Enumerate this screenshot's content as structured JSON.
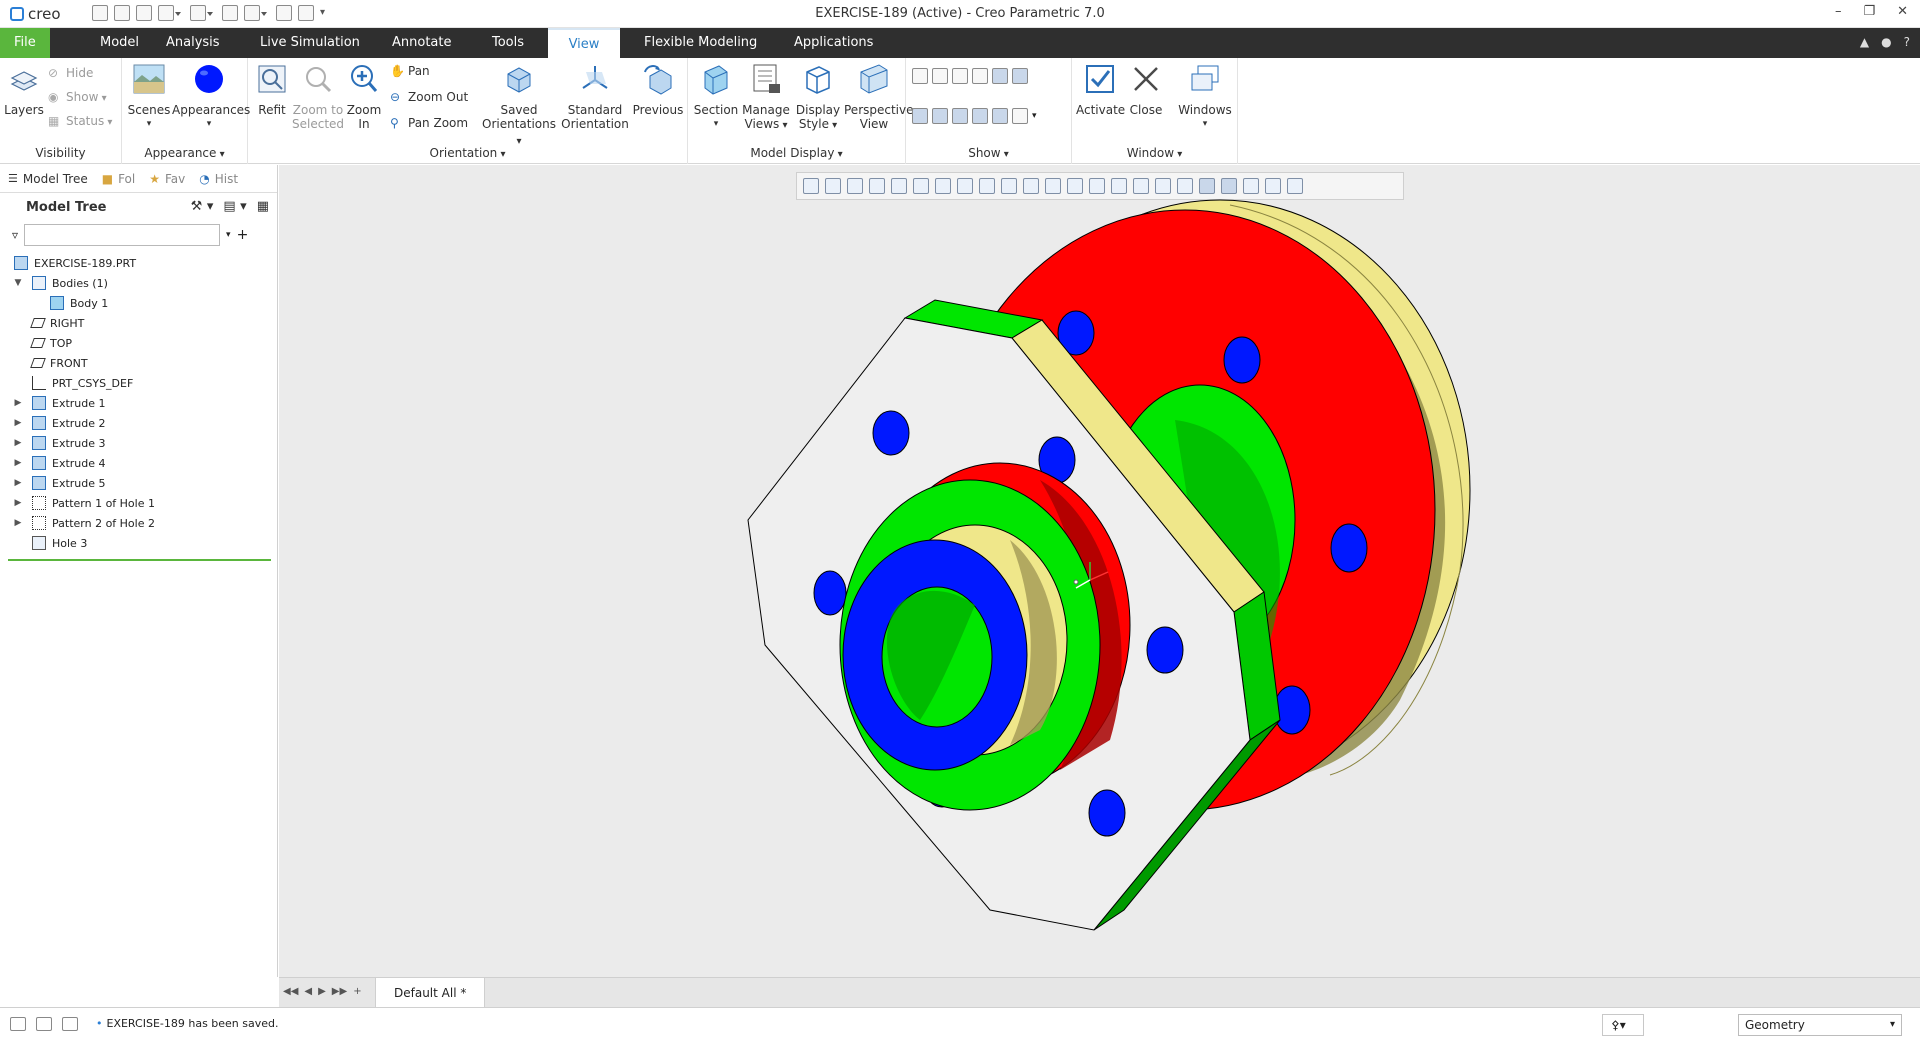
{
  "app": {
    "logo": "creo",
    "title": "EXERCISE-189 (Active) - Creo Parametric 7.0",
    "window_controls": [
      "–",
      "❐",
      "✕"
    ]
  },
  "tabs": [
    {
      "label": "File",
      "state": "file"
    },
    {
      "label": "Model"
    },
    {
      "label": "Analysis"
    },
    {
      "label": "Live Simulation"
    },
    {
      "label": "Annotate"
    },
    {
      "label": "Tools"
    },
    {
      "label": "View",
      "state": "active"
    },
    {
      "label": "Flexible Modeling"
    },
    {
      "label": "Applications"
    }
  ],
  "ribbon": {
    "visibility": {
      "group_label": "Visibility",
      "layers": "Layers",
      "hide": "Hide",
      "show": "Show",
      "status": "Status"
    },
    "appearance": {
      "group_label": "Appearance",
      "scenes": "Scenes",
      "appearances": "Appearances"
    },
    "orientation": {
      "group_label": "Orientation",
      "refit": "Refit",
      "zoom_to_selected_1": "Zoom to",
      "zoom_to_selected_2": "Selected",
      "zoom_in_1": "Zoom",
      "zoom_in_2": "In",
      "pan": "Pan",
      "zoom_out": "Zoom Out",
      "pan_zoom": "Pan Zoom",
      "saved_1": "Saved",
      "saved_2": "Orientations",
      "standard_1": "Standard",
      "standard_2": "Orientation",
      "previous": "Previous"
    },
    "model_display": {
      "group_label": "Model Display",
      "section": "Section",
      "manage_1": "Manage",
      "manage_2": "Views",
      "display_1": "Display",
      "display_2": "Style",
      "perspective_1": "Perspective",
      "perspective_2": "View"
    },
    "show": {
      "group_label": "Show"
    },
    "window": {
      "group_label": "Window",
      "activate": "Activate",
      "close": "Close",
      "windows": "Windows"
    }
  },
  "navigator": {
    "tabs": [
      {
        "label": "Model Tree"
      },
      {
        "label": "Fol"
      },
      {
        "label": "Fav"
      },
      {
        "label": "Hist"
      }
    ],
    "tree_title": "Model Tree",
    "filter_placeholder": "",
    "nodes": [
      {
        "label": "EXERCISE-189.PRT",
        "indent": 0,
        "toggle": "",
        "icon": "part"
      },
      {
        "label": "Bodies (1)",
        "indent": 1,
        "toggle": "▼",
        "icon": "bodies"
      },
      {
        "label": "Body 1",
        "indent": 2,
        "toggle": "",
        "icon": "body"
      },
      {
        "label": "RIGHT",
        "indent": 1,
        "toggle": "",
        "icon": "plane"
      },
      {
        "label": "TOP",
        "indent": 1,
        "toggle": "",
        "icon": "plane"
      },
      {
        "label": "FRONT",
        "indent": 1,
        "toggle": "",
        "icon": "plane"
      },
      {
        "label": "PRT_CSYS_DEF",
        "indent": 1,
        "toggle": "",
        "icon": "csys"
      },
      {
        "label": "Extrude 1",
        "indent": 1,
        "toggle": "▶",
        "icon": "extrude"
      },
      {
        "label": "Extrude 2",
        "indent": 1,
        "toggle": "▶",
        "icon": "extrude"
      },
      {
        "label": "Extrude 3",
        "indent": 1,
        "toggle": "▶",
        "icon": "extrude"
      },
      {
        "label": "Extrude 4",
        "indent": 1,
        "toggle": "▶",
        "icon": "extrude"
      },
      {
        "label": "Extrude 5",
        "indent": 1,
        "toggle": "▶",
        "icon": "extrude"
      },
      {
        "label": "Pattern 1 of Hole 1",
        "indent": 1,
        "toggle": "▶",
        "icon": "pattern"
      },
      {
        "label": "Pattern 2 of Hole 2",
        "indent": 1,
        "toggle": "▶",
        "icon": "pattern"
      },
      {
        "label": "Hole 3",
        "indent": 1,
        "toggle": "",
        "icon": "hole"
      }
    ]
  },
  "view_tab": {
    "label": "Default All *"
  },
  "status": {
    "message": "EXERCISE-189 has been saved.",
    "filter_value": "Geometry"
  },
  "colors": {
    "accent_green": "#5ab63d",
    "tab_active_text": "#2a7fc6",
    "model_red": "#ff0000",
    "model_green": "#00e600",
    "model_blue": "#0018ff",
    "model_yellow": "#efe78a",
    "model_face": "#efefef"
  }
}
